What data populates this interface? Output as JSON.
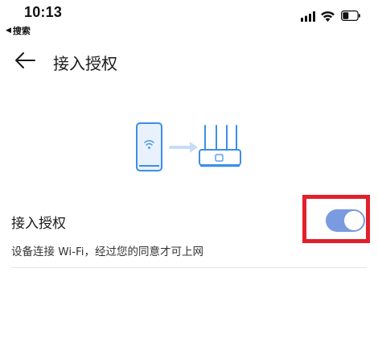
{
  "status_bar": {
    "time": "10:13",
    "back_app_label": "搜索",
    "back_app_arrow": "◀"
  },
  "header": {
    "title": "接入授权",
    "back_icon": "arrow-left-icon"
  },
  "illustration": {
    "icons": [
      "phone-wifi-icon",
      "arrow-right-icon",
      "router-icon"
    ]
  },
  "setting": {
    "title": "接入授权",
    "description": "设备连接 Wi-Fi，经过您的同意才可上网",
    "toggle_on": true,
    "toggle_color": "#7a9be0",
    "highlight_color": "#e1202b"
  },
  "colors": {
    "accent": "#3d8fe6"
  }
}
